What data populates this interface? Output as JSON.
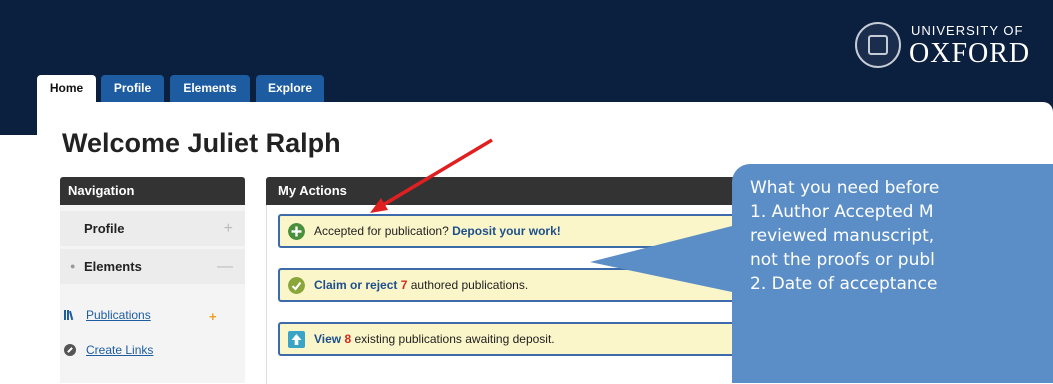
{
  "header": {
    "university_line1": "UNIVERSITY OF",
    "university_line2": "OXFORD"
  },
  "tabs": [
    {
      "label": "Home",
      "active": true
    },
    {
      "label": "Profile",
      "active": false
    },
    {
      "label": "Elements",
      "active": false
    },
    {
      "label": "Explore",
      "active": false
    }
  ],
  "page_title": "Welcome Juliet Ralph",
  "navigation": {
    "heading": "Navigation",
    "profile_label": "Profile",
    "elements_label": "Elements",
    "links": [
      {
        "label": "Publications",
        "icon": "books-icon"
      },
      {
        "label": "Create Links",
        "icon": "link-icon"
      }
    ]
  },
  "my_actions": {
    "heading": "My Actions",
    "items": [
      {
        "prefix": "Accepted for publication? ",
        "link": "Deposit your work!",
        "icon": "plus-circle-icon",
        "color": "#4a8f3c"
      },
      {
        "link": "Claim or reject",
        "count": "7",
        "suffix": " authored publications.",
        "icon": "check-circle-icon",
        "color": "#8aa53a"
      },
      {
        "link": "View",
        "count": "8",
        "suffix": " existing publications awaiting deposit.",
        "icon": "upload-icon",
        "color": "#3aa4c8"
      }
    ]
  },
  "callout": {
    "lines": [
      "What you need before",
      "1. Author Accepted M",
      "reviewed manuscript,",
      "not the proofs or publ",
      "2. Date of acceptance"
    ]
  },
  "colors": {
    "header_bg": "#0b1f3f",
    "tab_blue": "#1d5ca1",
    "callout_bg": "#5b8ec7",
    "action_bg": "#fbf6c9",
    "arrow": "#e02020"
  }
}
